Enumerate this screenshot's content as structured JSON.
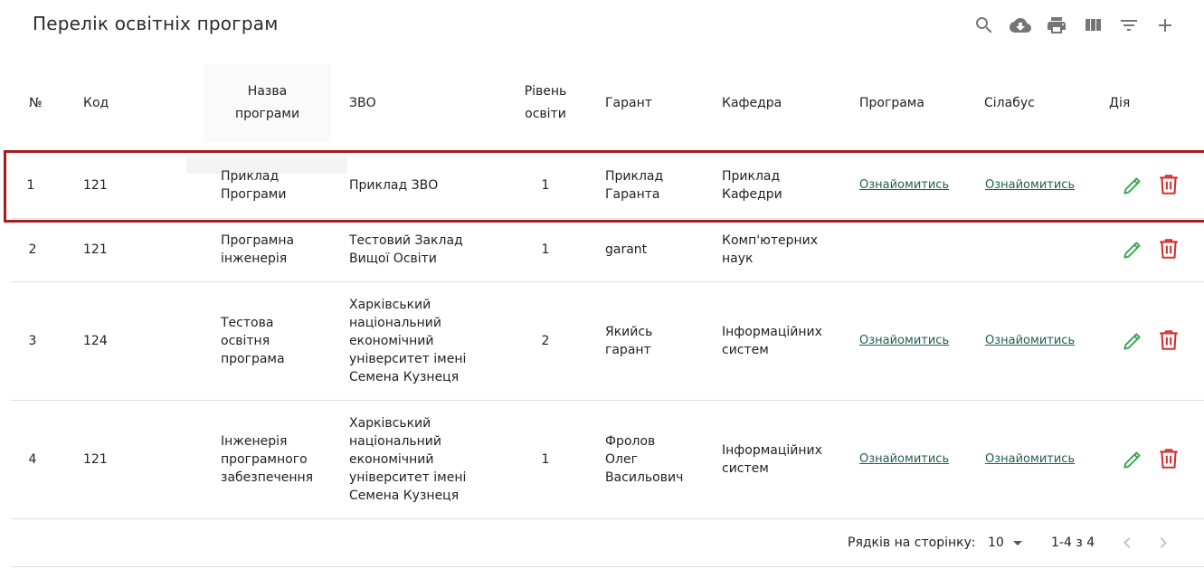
{
  "toolbar": {
    "title": "Перелік освітніх програм",
    "icons": [
      "search-icon",
      "cloud-download-icon",
      "print-icon",
      "view-columns-icon",
      "filter-icon",
      "add-icon"
    ]
  },
  "table": {
    "headers": {
      "num": "№",
      "code": "Код",
      "name_line1": "Назва",
      "name_line2": "програми",
      "zvo": "ЗВО",
      "level_line1": "Рівень",
      "level_line2": "освіти",
      "guarantor": "Гарант",
      "department": "Кафедра",
      "program": "Програма",
      "syllabus": "Сілабус",
      "action": "Дія"
    },
    "rows": [
      {
        "num": "1",
        "code": "121",
        "name": [
          "Приклад",
          "Програми"
        ],
        "zvo": [
          "Приклад ЗВО"
        ],
        "level": "1",
        "guarantor": [
          "Приклад",
          "Гаранта"
        ],
        "department": [
          "Приклад",
          "Кафедри"
        ],
        "program_link": "Ознайомитись",
        "syllabus_link": "Ознайомитись"
      },
      {
        "num": "2",
        "code": "121",
        "name": [
          "Програмна",
          "інженерія"
        ],
        "zvo": [
          "Тестовий Заклад",
          "Вищої Освіти"
        ],
        "level": "1",
        "guarantor": [
          "garant"
        ],
        "department": [
          "Комп'ютерних",
          "наук"
        ],
        "program_link": "",
        "syllabus_link": ""
      },
      {
        "num": "3",
        "code": "124",
        "name": [
          "Тестова",
          "освітня",
          "програма"
        ],
        "zvo": [
          "Харківський",
          "національний",
          "економічний",
          "університет імені",
          "Семена Кузнеця"
        ],
        "level": "2",
        "guarantor": [
          "Якийсь",
          "гарант"
        ],
        "department": [
          "Інформаційних",
          "систем"
        ],
        "program_link": "Ознайомитись",
        "syllabus_link": "Ознайомитись"
      },
      {
        "num": "4",
        "code": "121",
        "name": [
          "Інженерія",
          "програмного",
          "забезпечення"
        ],
        "zvo": [
          "Харківський",
          "національний",
          "економічний",
          "університет імені",
          "Семена Кузнеця"
        ],
        "level": "1",
        "guarantor": [
          "Фролов",
          "Олег",
          "Васильович"
        ],
        "department": [
          "Інформаційних",
          "систем"
        ],
        "program_link": "Ознайомитись",
        "syllabus_link": "Ознайомитись"
      }
    ]
  },
  "footer": {
    "rows_per_page_label": "Рядків на сторінку:",
    "rows_per_page_value": "10",
    "range": "1-4 з 4"
  },
  "colors": {
    "edit_icon": "#3aa655",
    "delete_icon": "#d32f2f",
    "link": "#1e5e52",
    "highlight_border": "#a61c1c"
  }
}
